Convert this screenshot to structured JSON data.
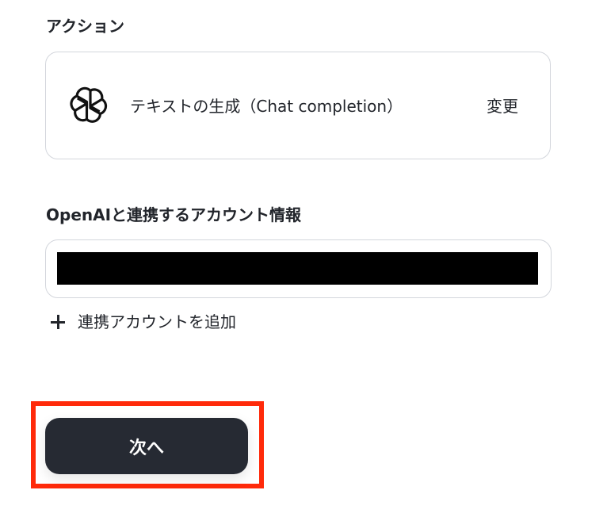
{
  "action_section": {
    "label": "アクション",
    "card": {
      "icon": "openai-logo-icon",
      "title": "テキストの生成（Chat completion）",
      "change_label": "変更"
    }
  },
  "account_section": {
    "label": "OpenAIと連携するアカウント情報",
    "selected_value_redacted": true,
    "add_account_label": "連携アカウントを追加"
  },
  "footer": {
    "next_label": "次へ",
    "highlight_color": "#ff2a0a"
  }
}
